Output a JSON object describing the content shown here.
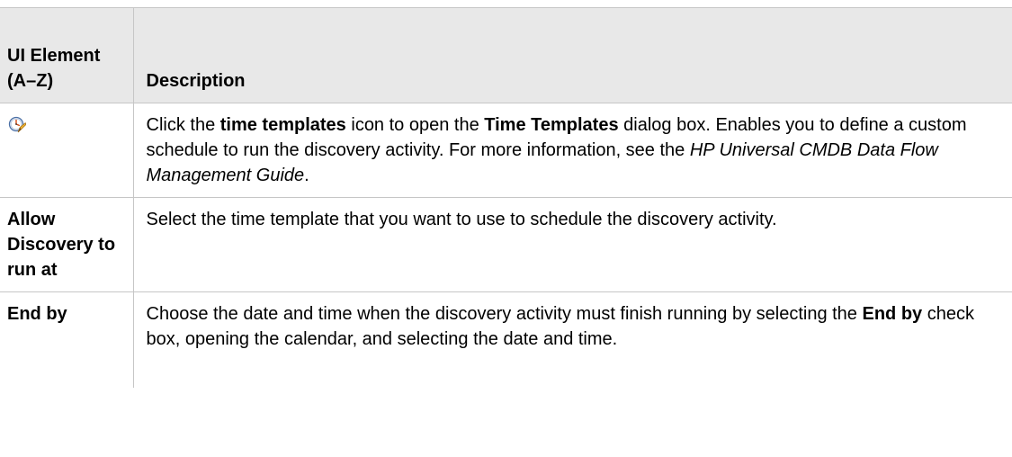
{
  "table": {
    "header": {
      "element_label": "UI Element (A–Z)",
      "description_label": "Description"
    },
    "rows": [
      {
        "element_icon": "time-templates-icon",
        "description": [
          {
            "text": "Click the ",
            "style": "normal"
          },
          {
            "text": "time templates",
            "style": "bold"
          },
          {
            "text": " icon to open the ",
            "style": "normal"
          },
          {
            "text": "Time Templates",
            "style": "bold"
          },
          {
            "text": " dialog box. Enables you to define a custom schedule to run the discovery activity. For more information, see the ",
            "style": "normal"
          },
          {
            "text": "HP Universal CMDB Data Flow Management Guide",
            "style": "italic"
          },
          {
            "text": ".",
            "style": "normal"
          }
        ]
      },
      {
        "element_label": "Allow Discovery to run at",
        "description": [
          {
            "text": "Select the time template that you want to use to schedule the discovery activity.",
            "style": "normal"
          }
        ]
      },
      {
        "element_label": "End by",
        "description": [
          {
            "text": "Choose the date and time when the discovery activity must finish running by selecting the ",
            "style": "normal"
          },
          {
            "text": "End by",
            "style": "bold"
          },
          {
            "text": " check box, opening the calendar, and selecting the date and time.",
            "style": "normal"
          }
        ]
      }
    ]
  },
  "colors": {
    "header_background": "#e8e8e8",
    "border": "#c6c6c6",
    "text": "#000000"
  }
}
